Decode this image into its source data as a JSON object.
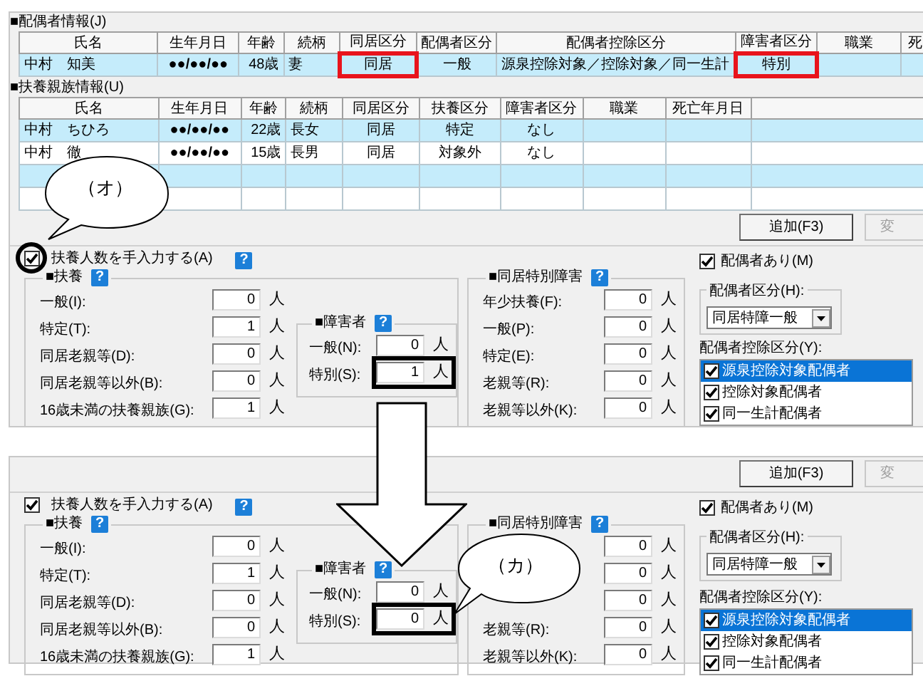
{
  "top": {
    "spouse_section": {
      "title": "■配偶者情報(J)",
      "columns": [
        "氏名",
        "生年月日",
        "年齢",
        "続柄",
        "同居区分",
        "配偶者区分",
        "配偶者控除区分",
        "障害者区分",
        "職業",
        "死"
      ],
      "rows": [
        {
          "cells": [
            {
              "text": "中村　知美",
              "highlighted": false
            },
            {
              "text": "●●/●●/●●",
              "highlighted": false
            },
            {
              "text": "48歳",
              "highlighted": false
            },
            {
              "text": "妻",
              "highlighted": false
            },
            {
              "text": "同居",
              "highlighted": true
            },
            {
              "text": "一般",
              "highlighted": false
            },
            {
              "text": "源泉控除対象／控除対象／同一生計",
              "highlighted": false
            },
            {
              "text": "特別",
              "highlighted": true
            },
            {
              "text": "",
              "highlighted": false
            },
            {
              "text": "",
              "highlighted": false
            }
          ]
        }
      ]
    },
    "dependents_section": {
      "title": "■扶養親族情報(U)",
      "columns": [
        "氏名",
        "生年月日",
        "年齢",
        "続柄",
        "同居区分",
        "扶養区分",
        "障害者区分",
        "職業",
        "死亡年月日",
        ""
      ],
      "rows": [
        [
          "中村　ちひろ",
          "●●/●●/●●",
          "22歳",
          "長女",
          "同居",
          "特定",
          "なし",
          "",
          "",
          ""
        ],
        [
          "中村　徹",
          "●●/●●/●●",
          "15歳",
          "長男",
          "同居",
          "対象外",
          "なし",
          "",
          "",
          ""
        ],
        [
          "",
          "",
          "",
          "",
          "",
          "",
          "",
          "",
          "",
          ""
        ],
        [
          "",
          "",
          "",
          "",
          "",
          "",
          "",
          "",
          "",
          ""
        ]
      ]
    },
    "buttons": [
      {
        "label": "追加(F3)",
        "disabled": false
      },
      {
        "label": "変",
        "disabled": true
      }
    ],
    "form": {
      "manual_input": {
        "label": "扶養人数を手入力する(A)",
        "checked": true,
        "circled": true,
        "help": "?"
      },
      "dependents_group": {
        "title": "■扶養",
        "help": "?",
        "rows": [
          {
            "label": "一般(I):",
            "value": "0",
            "unit": "人"
          },
          {
            "label": "特定(T):",
            "value": "1",
            "unit": "人"
          },
          {
            "label": "同居老親等(D):",
            "value": "0",
            "unit": "人"
          },
          {
            "label": "同居老親等以外(B):",
            "value": "0",
            "unit": "人"
          },
          {
            "label": "16歳未満の扶養親族(G):",
            "value": "1",
            "unit": "人"
          }
        ]
      },
      "disability_group": {
        "title": "■障害者",
        "help": "?",
        "rows": [
          {
            "label": "一般(N):",
            "value": "0",
            "unit": "人",
            "highlighted": false
          },
          {
            "label": "特別(S):",
            "value": "1",
            "unit": "人",
            "highlighted": true
          }
        ]
      },
      "cohabiting_group": {
        "title": "■同居特別障害",
        "help": "?",
        "rows": [
          {
            "label": "年少扶養(F):",
            "value": "0",
            "unit": "人"
          },
          {
            "label": "一般(P):",
            "value": "0",
            "unit": "人"
          },
          {
            "label": "特定(E):",
            "value": "0",
            "unit": "人"
          },
          {
            "label": "老親等(R):",
            "value": "0",
            "unit": "人"
          },
          {
            "label": "老親等以外(K):",
            "value": "0",
            "unit": "人"
          }
        ]
      },
      "spouse": {
        "has_spouse": {
          "label": "配偶者あり(M)",
          "checked": true
        },
        "category": {
          "label": "配偶者区分(H):",
          "value": "同居特障一般"
        },
        "deduction": {
          "label": "配偶者控除区分(Y):",
          "items": [
            {
              "label": "源泉控除対象配偶者",
              "checked": true,
              "selected": true
            },
            {
              "label": "控除対象配偶者",
              "checked": true,
              "selected": false
            },
            {
              "label": "同一生計配偶者",
              "checked": true,
              "selected": false
            }
          ]
        }
      }
    }
  },
  "bottom": {
    "buttons": [
      {
        "label": "追加(F3)",
        "disabled": false
      },
      {
        "label": "変",
        "disabled": true
      }
    ],
    "form": {
      "manual_input": {
        "label": "扶養人数を手入力する(A)",
        "checked": true,
        "circled": false,
        "help": "?"
      },
      "dependents_group": {
        "title": "■扶養",
        "help": "?",
        "rows": [
          {
            "label": "一般(I):",
            "value": "0",
            "unit": "人"
          },
          {
            "label": "特定(T):",
            "value": "1",
            "unit": "人"
          },
          {
            "label": "同居老親等(D):",
            "value": "0",
            "unit": "人"
          },
          {
            "label": "同居老親等以外(B):",
            "value": "0",
            "unit": "人"
          },
          {
            "label": "16歳未満の扶養親族(G):",
            "value": "1",
            "unit": "人"
          }
        ]
      },
      "disability_group": {
        "title": "■障害者",
        "help": "?",
        "rows": [
          {
            "label": "一般(N):",
            "value": "0",
            "unit": "人",
            "highlighted": false
          },
          {
            "label": "特別(S):",
            "value": "0",
            "unit": "人",
            "highlighted": true
          }
        ]
      },
      "cohabiting_group": {
        "title": "■同居特別障害",
        "help": "?",
        "rows": [
          {
            "value": "0",
            "unit": "人"
          },
          {
            "value": "0",
            "unit": "人"
          },
          {
            "value": "0",
            "unit": "人"
          },
          {
            "label": "老親等(R):",
            "value": "0",
            "unit": "人"
          },
          {
            "label": "老親等以外(K):",
            "value": "0",
            "unit": "人"
          }
        ]
      },
      "spouse": {
        "has_spouse": {
          "label": "配偶者あり(M)",
          "checked": true
        },
        "category": {
          "label": "配偶者区分(H):",
          "value": "同居特障一般"
        },
        "deduction": {
          "label": "配偶者控除区分(Y):",
          "items": [
            {
              "label": "源泉控除対象配偶者",
              "checked": true,
              "selected": true
            },
            {
              "label": "控除対象配偶者",
              "checked": true,
              "selected": false
            },
            {
              "label": "同一生計配偶者",
              "checked": true,
              "selected": false
            }
          ]
        }
      }
    }
  },
  "callouts": [
    "（オ）",
    "（カ）"
  ]
}
